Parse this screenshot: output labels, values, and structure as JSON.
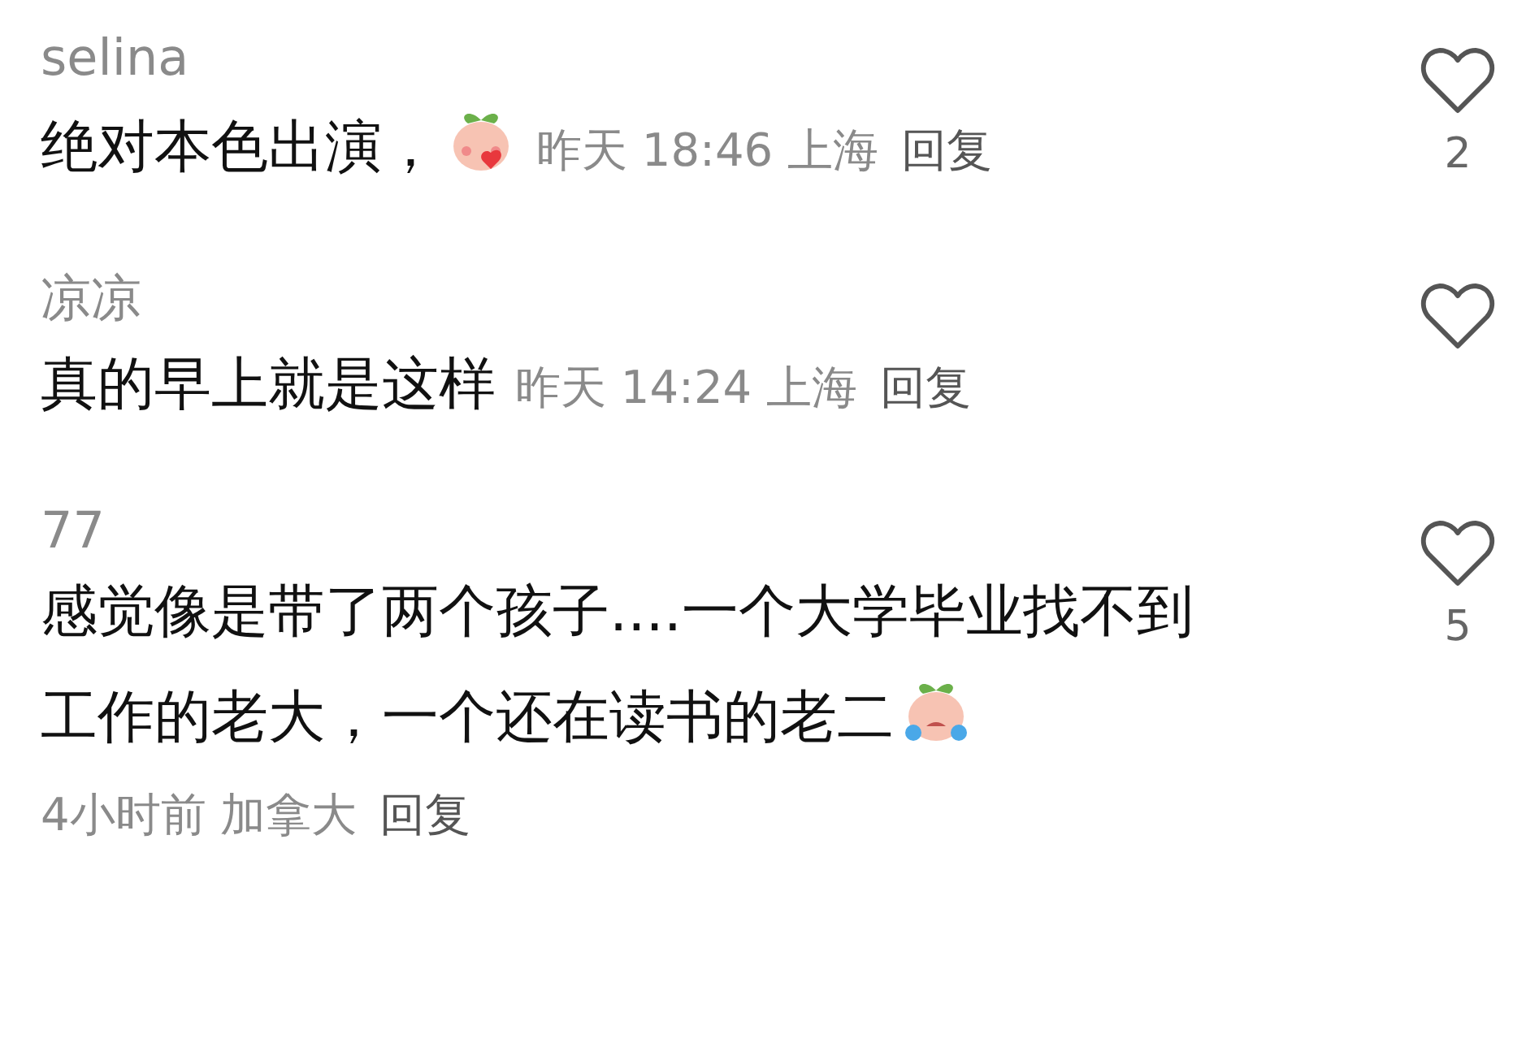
{
  "comments": [
    {
      "username": "selina",
      "lines": [
        "绝对本色出演，"
      ],
      "emoji": true,
      "time": "昨天 18:46",
      "location": "上海",
      "reply": "回复",
      "likes": "2"
    },
    {
      "username": "凉凉",
      "lines": [
        "真的早上就是这样"
      ],
      "emoji": false,
      "time": "昨天 14:24",
      "location": "上海",
      "reply": "回复"
    },
    {
      "username": "77",
      "lines": [
        "感觉像是带了两个孩子....一个大学毕业找不到",
        "工作的老大，一个还在读书的老二"
      ],
      "emoji": true,
      "time": "4小时前",
      "location": "加拿大",
      "reply": "回复",
      "likes": "5"
    }
  ]
}
